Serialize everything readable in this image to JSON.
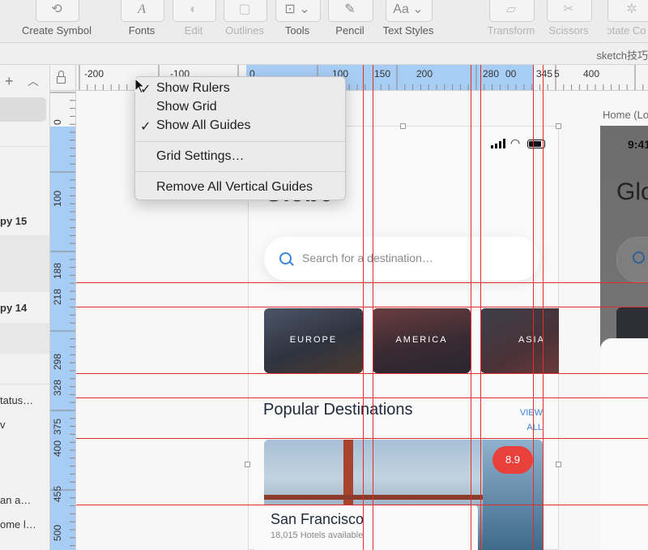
{
  "toolbar": {
    "items": [
      {
        "label": "Create Symbol",
        "icon": "create-symbol-icon",
        "glyph": "⟲",
        "enabled": true
      },
      {
        "label": "Fonts",
        "icon": "fonts-icon",
        "glyph": "A",
        "enabled": true
      },
      {
        "label": "Edit",
        "icon": "edit-icon",
        "glyph": "◐",
        "enabled": false
      },
      {
        "label": "Outlines",
        "icon": "outlines-icon",
        "glyph": "▢",
        "enabled": false
      },
      {
        "label": "Tools",
        "icon": "tools-icon",
        "glyph": "⊡ ⌄",
        "enabled": true
      },
      {
        "label": "Pencil",
        "icon": "pencil-icon",
        "glyph": "✎",
        "enabled": true
      },
      {
        "label": "Text Styles",
        "icon": "text-styles-icon",
        "glyph": "Aa ⌄",
        "enabled": true
      },
      {
        "label": "Transform",
        "icon": "transform-icon",
        "glyph": "▱",
        "enabled": false
      },
      {
        "label": "Scissors",
        "icon": "scissors-icon",
        "glyph": "✂",
        "enabled": false
      },
      {
        "label": "Rotate Co",
        "icon": "rotate-copies-icon",
        "glyph": "✲",
        "enabled": false
      }
    ]
  },
  "tab": {
    "title": "sketch技巧"
  },
  "layers": {
    "rows": [
      {
        "text": "py 15",
        "bold": true
      },
      {
        "text": "py 14",
        "bold": true
      },
      {
        "text": "tatus…",
        "bold": false
      },
      {
        "text": "v",
        "bold": false
      },
      {
        "text": "an a…",
        "bold": false
      },
      {
        "text": "ome l…",
        "bold": false
      }
    ]
  },
  "ruler_top": {
    "labels": [
      "-200",
      "-100",
      "0",
      "100",
      "150",
      "200",
      "280",
      "00",
      "345",
      "5",
      "400"
    ]
  },
  "ruler_left": {
    "labels": [
      "0",
      "100",
      "188",
      "218",
      "298",
      "328",
      "375",
      "400",
      "455",
      "500"
    ]
  },
  "menu": {
    "items": [
      {
        "label": "Show Rulers",
        "checked": true
      },
      {
        "label": "Show Grid",
        "checked": false
      },
      {
        "label": "Show All Guides",
        "checked": true
      },
      {
        "label": "Grid Settings…",
        "checked": false
      },
      {
        "label": "Remove All Vertical Guides",
        "checked": false
      }
    ],
    "check_glyph": "✓"
  },
  "app": {
    "title_partial": "Globe",
    "search_placeholder": "Search for a destination…",
    "categories": [
      "EUROPE",
      "AMERICA",
      "ASIA"
    ],
    "section_title": "Popular Destinations",
    "view_all": [
      "VIEW",
      "ALL"
    ],
    "rating": "8.9",
    "destination_name": "San Francisco",
    "destination_sub": "18,015 Hotels available"
  },
  "artboard2": {
    "label": "Home (Lo",
    "time": "9:41",
    "title_partial": "Glo"
  },
  "colors": {
    "guide": "#e02e2e",
    "ruler_selection": "#a8cdf5",
    "accent": "#3b86d9",
    "badge": "#e8413c"
  }
}
